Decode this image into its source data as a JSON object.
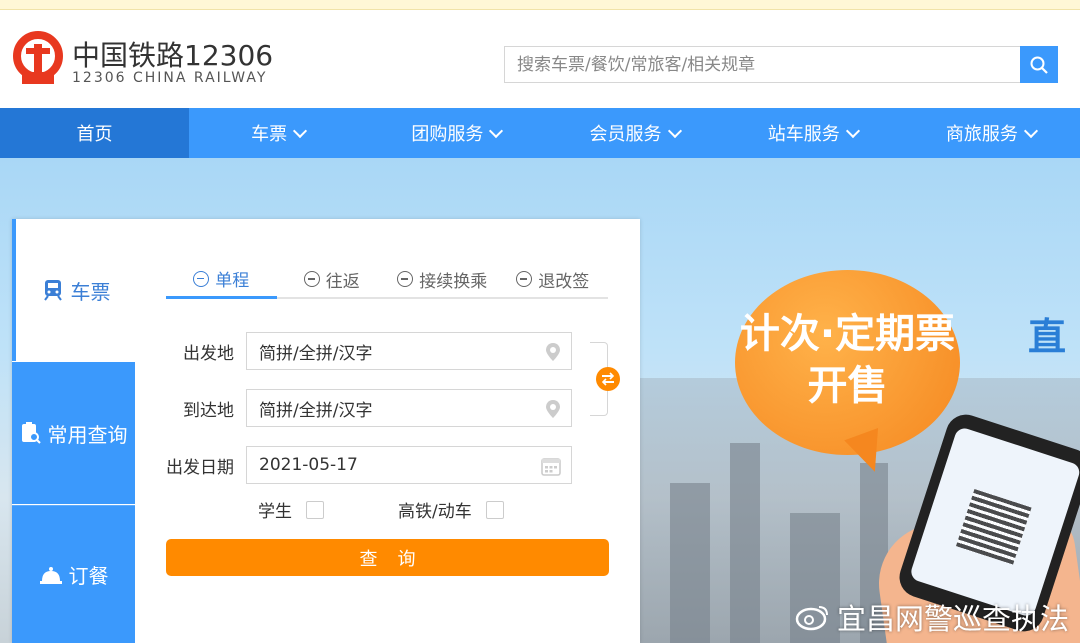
{
  "header": {
    "brand_cn": "中国铁路12306",
    "brand_en": "12306 CHINA RAILWAY",
    "search_placeholder": "搜索车票/餐饮/常旅客/相关规章"
  },
  "nav": {
    "items": [
      {
        "label": "首页",
        "active": true,
        "dropdown": false
      },
      {
        "label": "车票",
        "dropdown": true
      },
      {
        "label": "团购服务",
        "dropdown": true
      },
      {
        "label": "会员服务",
        "dropdown": true
      },
      {
        "label": "站车服务",
        "dropdown": true
      },
      {
        "label": "商旅服务",
        "dropdown": true
      }
    ]
  },
  "sidebar": {
    "items": [
      {
        "label": "车票",
        "icon": "train-icon",
        "active": true
      },
      {
        "label": "常用查询",
        "icon": "clipboard-search-icon"
      },
      {
        "label": "订餐",
        "icon": "dining-bell-icon"
      }
    ]
  },
  "booking": {
    "tabs": [
      {
        "label": "单程",
        "icon": "minus-circle-icon",
        "active": true
      },
      {
        "label": "往返",
        "icon": "equals-circle-icon"
      },
      {
        "label": "接续换乘",
        "icon": "refresh-circle-icon"
      },
      {
        "label": "退改签",
        "icon": "ticket-circle-icon"
      }
    ],
    "from_label": "出发地",
    "from_placeholder": "简拼/全拼/汉字",
    "to_label": "到达地",
    "to_placeholder": "简拼/全拼/汉字",
    "date_label": "出发日期",
    "date_value": "2021-05-17",
    "student_label": "学生",
    "hsr_label": "高铁/动车",
    "query_label": "查询"
  },
  "banner": {
    "bubble_line1": "计次·定期票",
    "bubble_line2": "开售",
    "side_text": "直"
  },
  "watermark": "宜昌网警巡查执法",
  "colors": {
    "brand_blue": "#3b99fc",
    "nav_active": "#2477d6",
    "accent_orange": "#ff8a00",
    "logo_red": "#e8381f"
  }
}
